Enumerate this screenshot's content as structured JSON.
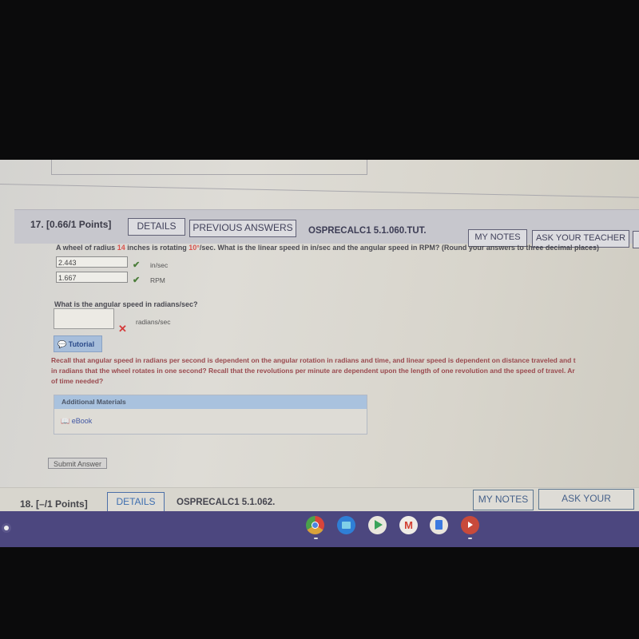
{
  "question17": {
    "number": "17.",
    "points": "[0.66/1 Points]",
    "details_label": "DETAILS",
    "previous_answers_label": "PREVIOUS ANSWERS",
    "code": "OSPRECALC1 5.1.060.TUT.",
    "my_notes_label": "MY NOTES",
    "ask_teacher_label": "ASK YOUR TEACHER",
    "prompt": {
      "part1": "A wheel of radius ",
      "radius": "14",
      "part2": " inches is rotating ",
      "rate": "10°",
      "part3": "/sec. What is the linear speed in in/sec and the angular speed in RPM? (Round your answers to three decimal places)"
    },
    "answers": [
      {
        "value": "2.443",
        "unit": "in/sec",
        "status": "correct"
      },
      {
        "value": "1.667",
        "unit": "RPM",
        "status": "correct"
      }
    ],
    "subquestion": "What is the angular speed in radians/sec?",
    "sub_answer": {
      "value": "",
      "unit": "radians/sec",
      "status": "incorrect"
    },
    "tutorial_label": "Tutorial",
    "recall_lines": [
      "Recall that angular speed in radians per second is dependent on the angular rotation in radians and time, and linear speed is dependent on distance traveled and t",
      "in radians that the wheel rotates in one second? Recall that the revolutions per minute are dependent upon the length of one revolution and the speed of travel. Ar",
      "of time needed?"
    ],
    "additional_materials_label": "Additional Materials",
    "ebook_label": "eBook",
    "submit_label": "Submit Answer"
  },
  "question18": {
    "number": "18.",
    "points": "[–/1 Points]",
    "details_label": "DETAILS",
    "code": "OSPRECALC1 5.1.062.",
    "my_notes_label": "MY NOTES",
    "ask_teacher_label": "ASK YOUR TEACHER"
  },
  "shelf": {
    "apps": [
      {
        "name": "chrome",
        "color": "#d9a23a",
        "running": true
      },
      {
        "name": "files",
        "color": "#2f7fd6",
        "running": false
      },
      {
        "name": "play-store",
        "color": "#e9e6dd",
        "running": false
      },
      {
        "name": "gmail",
        "color": "#efece6",
        "running": false
      },
      {
        "name": "docs",
        "color": "#e9e6dd",
        "running": false
      },
      {
        "name": "youtube",
        "color": "#c84a3b",
        "running": true
      }
    ]
  },
  "colors": {
    "accent_red": "#d9534f",
    "correct_green": "#4b7d3a",
    "shelf": "#4c477f"
  }
}
